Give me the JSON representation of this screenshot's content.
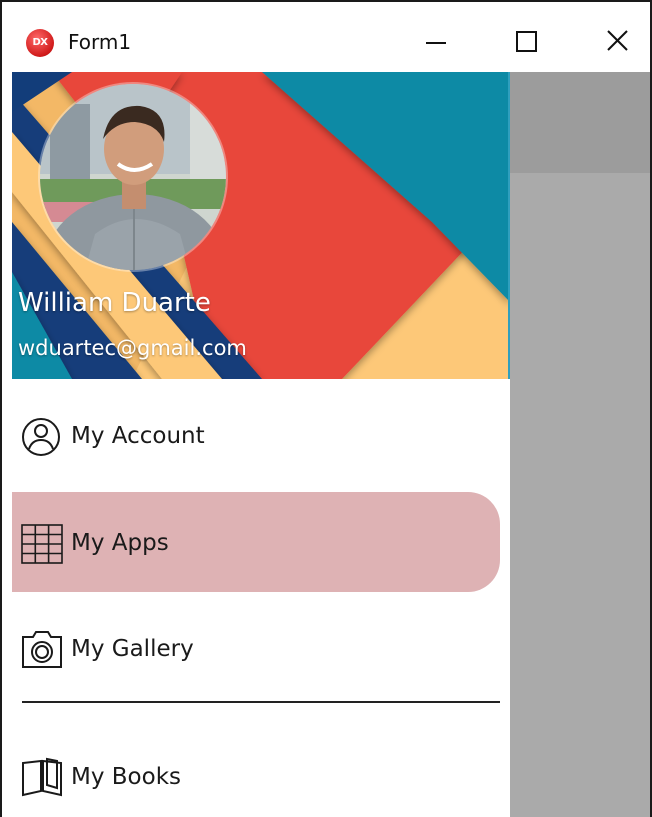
{
  "window": {
    "title": "Form1",
    "app_icon_text": "DX",
    "controls": {
      "minimize": "minimize-icon",
      "maximize": "maximize-icon",
      "close": "close-icon"
    }
  },
  "drawer": {
    "header": {
      "user_name": "William Duarte",
      "user_email": "wduartec@gmail.com",
      "background_colors": [
        "#fdc878",
        "#e8473b",
        "#0f8aa5",
        "#123d7a"
      ]
    },
    "items": [
      {
        "label": "My Account",
        "icon": "account-circle-icon",
        "selected": false
      },
      {
        "label": "My Apps",
        "icon": "apps-grid-icon",
        "selected": true
      },
      {
        "label": "My Gallery",
        "icon": "camera-icon",
        "selected": false
      },
      {
        "label": "My Books",
        "icon": "book-icon",
        "selected": false
      }
    ],
    "selected_color": "#deb2b4"
  },
  "content": {
    "background": "#aaaaaa",
    "header_background": "#9c9c9c"
  }
}
